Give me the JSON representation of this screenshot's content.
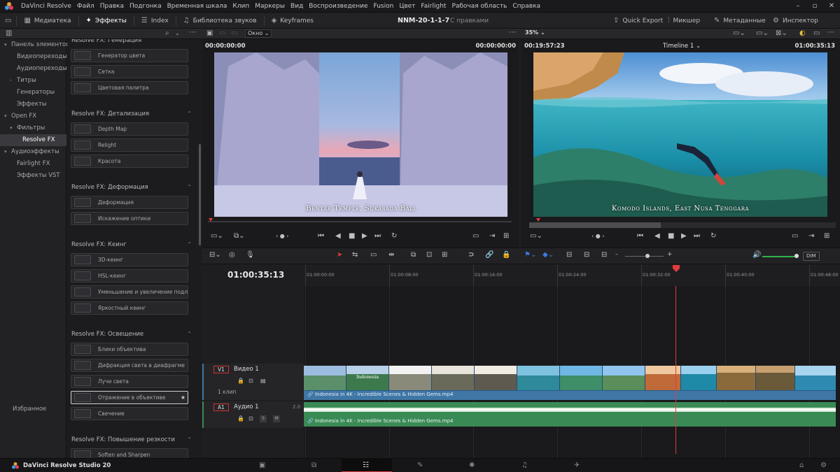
{
  "menubar": {
    "items": [
      "DaVinci Resolve",
      "Файл",
      "Правка",
      "Подгонка",
      "Временная шкала",
      "Клип",
      "Маркеры",
      "Вид",
      "Воспроизведение",
      "Fusion",
      "Цвет",
      "Fairlight",
      "Рабочая область",
      "Справка"
    ]
  },
  "toolbar": {
    "media_pool": "Медиатека",
    "effects": "Эффекты",
    "index": "Index",
    "sound_library": "Библиотека звуков",
    "keyframes": "Keyframes",
    "project_title": "NNM-20-1-1-7",
    "project_status": "С правками",
    "quick_export": "Quick Export",
    "mixer": "Микшер",
    "metadata": "Метаданные",
    "inspector": "Инспектор"
  },
  "viewer_controls": {
    "window_mode": "Окно",
    "zoom": "35%",
    "timeline_name": "Timeline 1"
  },
  "tree": {
    "items": [
      {
        "label": "Панель элементов",
        "arrow": "▾",
        "indent": 0
      },
      {
        "label": "Видеопереходы",
        "arrow": "",
        "indent": 1
      },
      {
        "label": "Аудиопереходы",
        "arrow": "",
        "indent": 1
      },
      {
        "label": "Титры",
        "arrow": "›",
        "indent": 1
      },
      {
        "label": "Генераторы",
        "arrow": "",
        "indent": 1
      },
      {
        "label": "Эффекты",
        "arrow": "",
        "indent": 1
      },
      {
        "label": "Open FX",
        "arrow": "▾",
        "indent": 0
      },
      {
        "label": "Фильтры",
        "arrow": "▾",
        "indent": 1
      },
      {
        "label": "Resolve FX",
        "arrow": "",
        "indent": 2,
        "selected": true
      },
      {
        "label": "Аудиоэффекты",
        "arrow": "▾",
        "indent": 0
      },
      {
        "label": "Fairlight FX",
        "arrow": "",
        "indent": 1
      },
      {
        "label": "Эффекты VST",
        "arrow": "",
        "indent": 1
      }
    ],
    "favorites": "Избранное"
  },
  "fx": {
    "groups": [
      {
        "title": "Resolve FX: Генерация",
        "items": [
          "Генератор цвета",
          "Сетка",
          "Цветовая палитра"
        ]
      },
      {
        "title": "Resolve FX: Детализация",
        "items": [
          "Depth Map",
          "Relight",
          "Красота"
        ]
      },
      {
        "title": "Resolve FX: Деформация",
        "items": [
          "Деформация",
          "Искажение оптики"
        ]
      },
      {
        "title": "Resolve FX: Кеинг",
        "items": [
          "3D-кеинг",
          "HSL-кеинг",
          "Уменьшение и увеличение подл...",
          "Яркостный кеинг"
        ]
      },
      {
        "title": "Resolve FX: Освещение",
        "items": [
          "Блики объектива",
          "Дифракция света в диафрагме",
          "Лучи света",
          "Отражение в объективе",
          "Свечение"
        ]
      },
      {
        "title": "Resolve FX: Повышение резкости",
        "items": [
          "Soften and Sharpen"
        ]
      }
    ],
    "highlighted": "Отражение в объективе"
  },
  "viewer_left": {
    "tc_left": "00:00:00:00",
    "tc_right": "00:00:00:00",
    "caption": "Bentar Temple, Sukasada Bali"
  },
  "viewer_right": {
    "tc_left": "00:19:57:23",
    "tc_right": "01:00:35:13",
    "caption": "Komodo Islands, East Nusa Tenggara"
  },
  "timeline": {
    "timecode": "01:00:35:13",
    "ruler": [
      "01:00:00:00",
      "01:00:08:00",
      "01:00:16:00",
      "01:00:24:00",
      "01:00:32:00",
      "01:00:40:00",
      "01:00:48:00"
    ],
    "video_track": {
      "id": "V1",
      "name": "Видео 1",
      "clips": "1 клип",
      "clip_name": "Indonesia in 4K - Incredible Scenes & Hidden Gems.mp4",
      "thumb_text": "Indonesia"
    },
    "audio_track": {
      "id": "A1",
      "name": "Аудио 1",
      "level": "2.0",
      "clip_name": "Indonesia in 4K - Incredible Scenes & Hidden Gems.mp4",
      "solo": "S",
      "mute": "M"
    },
    "dim": "DIM"
  },
  "status": {
    "app_name": "DaVinci Resolve Studio 20"
  },
  "colors": {
    "playhead": "#e03c3c",
    "video_clip": "#3f76a6",
    "audio_clip": "#3a8a56",
    "accent": "#1f6fd1"
  }
}
